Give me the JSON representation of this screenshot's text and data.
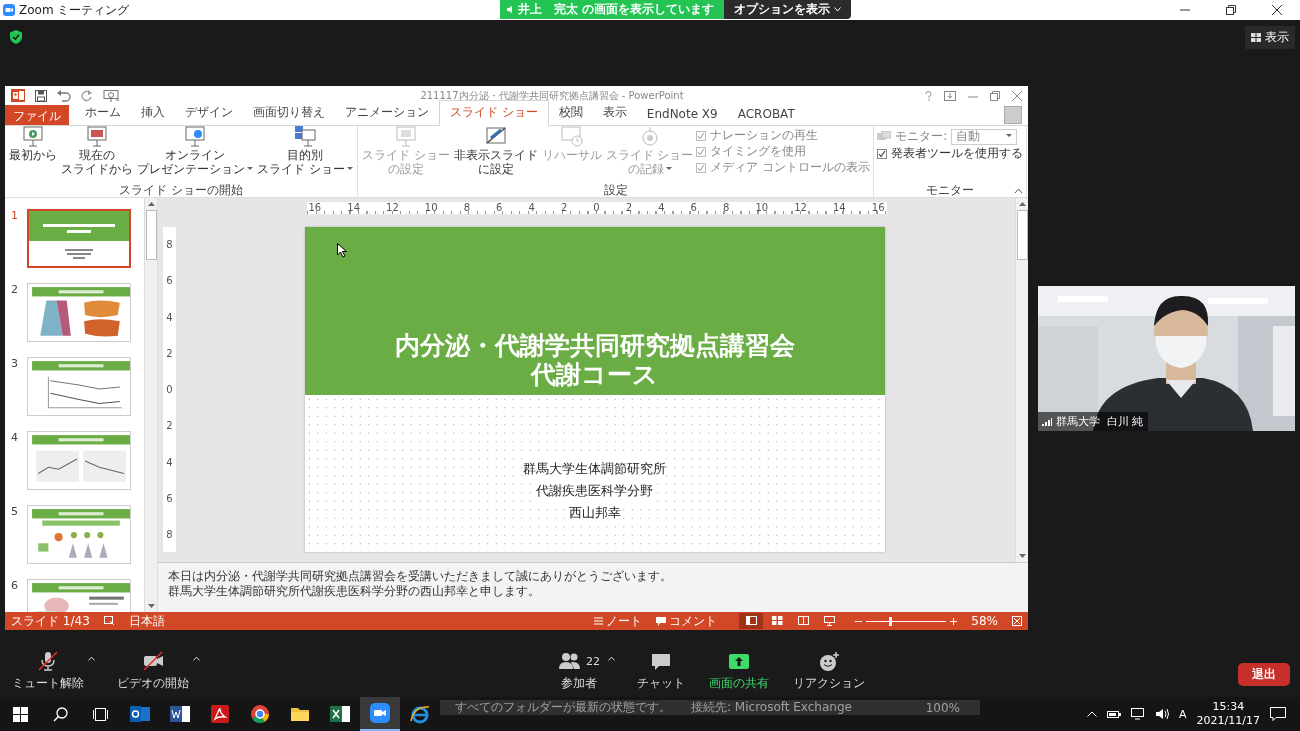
{
  "zoom_window": {
    "title": "Zoom ミーティング",
    "banner": "井上　完太 の画面を表示しています",
    "options_button": "オプションを表示",
    "view_button": "表示"
  },
  "powerpoint": {
    "title": "211117内分泌・代謝学共同研究拠点講習会 - PowerPoint",
    "tabs": [
      {
        "label": "ファイル",
        "kind": "file",
        "selected": false
      },
      {
        "label": "ホーム",
        "kind": "tab",
        "selected": false
      },
      {
        "label": "挿入",
        "kind": "tab",
        "selected": false
      },
      {
        "label": "デザイン",
        "kind": "tab",
        "selected": false
      },
      {
        "label": "画面切り替え",
        "kind": "tab",
        "selected": false
      },
      {
        "label": "アニメーション",
        "kind": "tab",
        "selected": false
      },
      {
        "label": "スライド ショー",
        "kind": "tab",
        "selected": true
      },
      {
        "label": "校閲",
        "kind": "tab",
        "selected": false
      },
      {
        "label": "表示",
        "kind": "tab",
        "selected": false
      },
      {
        "label": "EndNote X9",
        "kind": "tab",
        "selected": false
      },
      {
        "label": "ACROBAT",
        "kind": "tab",
        "selected": false
      }
    ],
    "ribbon_groups": [
      {
        "label": "スライド ショーの開始",
        "items": [
          {
            "kind": "large",
            "lines": [
              "最初から"
            ],
            "disabled": false,
            "dropdown": false
          },
          {
            "kind": "large",
            "lines": [
              "現在の",
              "スライドから"
            ],
            "disabled": false,
            "dropdown": false
          },
          {
            "kind": "large",
            "lines": [
              "オンライン",
              "プレゼンテーション"
            ],
            "disabled": false,
            "dropdown": true
          },
          {
            "kind": "large",
            "lines": [
              "目的別",
              "スライド ショー"
            ],
            "disabled": false,
            "dropdown": true
          }
        ]
      },
      {
        "label": "設定",
        "items": [
          {
            "kind": "large",
            "lines": [
              "スライド ショー",
              "の設定"
            ],
            "disabled": true,
            "dropdown": false
          },
          {
            "kind": "large",
            "lines": [
              "非表示スライド",
              "に設定"
            ],
            "disabled": false,
            "dropdown": false
          },
          {
            "kind": "large",
            "lines": [
              "リハーサル"
            ],
            "disabled": true,
            "dropdown": false
          },
          {
            "kind": "large",
            "lines": [
              "スライド ショー",
              "の記録"
            ],
            "disabled": true,
            "dropdown": true
          },
          {
            "kind": "stack",
            "items": [
              {
                "kind": "check",
                "label": "ナレーションの再生",
                "checked": true,
                "disabled": true
              },
              {
                "kind": "check",
                "label": "タイミングを使用",
                "checked": true,
                "disabled": true
              },
              {
                "kind": "check",
                "label": "メディア コントロールの表示",
                "checked": true,
                "disabled": true
              }
            ]
          }
        ]
      },
      {
        "label": "モニター",
        "items": [
          {
            "kind": "stack",
            "items": [
              {
                "kind": "select",
                "label": "モニター:",
                "value": "自動",
                "disabled": true
              },
              {
                "kind": "check",
                "label": "発表者ツールを使用する",
                "checked": true,
                "disabled": false
              }
            ]
          }
        ]
      }
    ],
    "slides": [
      {
        "number": "1",
        "kind": "title",
        "selected": true
      },
      {
        "number": "2",
        "kind": "maps",
        "selected": false
      },
      {
        "number": "3",
        "kind": "line_chart",
        "selected": false
      },
      {
        "number": "4",
        "kind": "charts",
        "selected": false
      },
      {
        "number": "5",
        "kind": "icons",
        "selected": false
      },
      {
        "number": "6",
        "kind": "diagram",
        "selected": false
      }
    ],
    "ruler_h": [
      "16",
      "14",
      "12",
      "10",
      "8",
      "6",
      "4",
      "2",
      "0",
      "2",
      "4",
      "6",
      "8",
      "10",
      "12",
      "14",
      "16"
    ],
    "ruler_v": [
      "8",
      "6",
      "4",
      "2",
      "0",
      "2",
      "4",
      "6",
      "8"
    ],
    "slide": {
      "title_lines": [
        "内分泌・代謝学共同研究拠点講習会",
        "代謝コース"
      ],
      "body_lines": [
        "群馬大学生体調節研究所",
        "代謝疾患医科学分野",
        "西山邦幸"
      ]
    },
    "notes": [
      "本日は内分泌・代謝学共同研究拠点講習会を受講いただきまして誠にありがとうございます。",
      "群馬大学生体調節研究所代謝疾患医科学分野の西山邦幸と申します。"
    ],
    "status_bar": {
      "slide": "スライド 1/43",
      "language": "日本語",
      "notes": "ノート",
      "comments": "コメント",
      "views": [
        {
          "kind": "normal",
          "selected": true
        },
        {
          "kind": "sorter",
          "selected": false
        },
        {
          "kind": "reading",
          "selected": false
        },
        {
          "kind": "show",
          "selected": false
        }
      ],
      "zoom_slider": {
        "level": 0.28
      },
      "zoom": "58%"
    }
  },
  "video": {
    "name": "群馬大学  白川 純"
  },
  "meeting_controls": {
    "left": [
      {
        "kind": "mute",
        "label": "ミュート解除",
        "off": true
      },
      {
        "kind": "video",
        "label": "ビデオの開始",
        "off": true
      }
    ],
    "center": [
      {
        "kind": "participants",
        "label": "参加者",
        "count": "22"
      },
      {
        "kind": "chat",
        "label": "チャット"
      },
      {
        "kind": "share",
        "label": "画面の共有"
      },
      {
        "kind": "reaction",
        "label": "リアクション"
      }
    ],
    "leave": "退出"
  },
  "taskbar": {
    "apps": [
      {
        "kind": "outlook",
        "selected": false
      },
      {
        "kind": "word",
        "selected": false
      },
      {
        "kind": "acrobat",
        "selected": false
      },
      {
        "kind": "chrome",
        "selected": false
      },
      {
        "kind": "explorer",
        "selected": false
      },
      {
        "kind": "excel",
        "selected": false
      },
      {
        "kind": "zoom",
        "selected": true
      },
      {
        "kind": "ie",
        "selected": false
      }
    ],
    "background_status": [
      "すべてのフォルダーが最新の状態です。",
      "接続先: Microsoft Exchange",
      "100%"
    ],
    "time": "15:34",
    "date": "2021/11/17",
    "ime": "A"
  }
}
